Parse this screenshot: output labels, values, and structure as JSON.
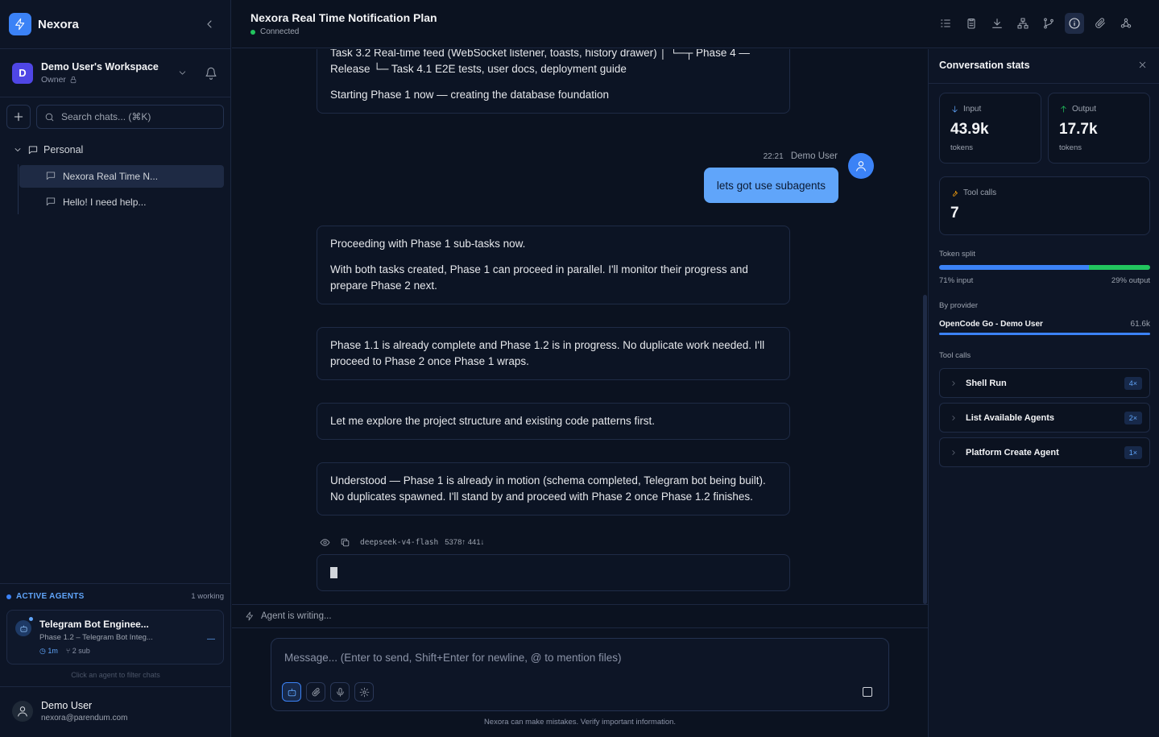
{
  "app": {
    "name": "Nexora",
    "accent_color": "#3b82f6"
  },
  "sidebar": {
    "workspace": {
      "avatar_letter": "D",
      "name": "Demo User's Workspace",
      "role": "Owner"
    },
    "search_placeholder": "Search chats... (⌘K)",
    "folder": {
      "name": "Personal"
    },
    "chats": [
      {
        "title": "Nexora Real Time N...",
        "active": true
      },
      {
        "title": "Hello! I need help...",
        "active": false
      }
    ],
    "active_agents": {
      "title": "ACTIVE AGENTS",
      "count": "1 working",
      "agent": {
        "name": "Telegram Bot Enginee...",
        "subtitle": "Phase 1.2 – Telegram Bot Integ...",
        "time": "1m",
        "sub": "2 sub"
      },
      "hint": "Click an agent to filter chats"
    },
    "user": {
      "name": "Demo User",
      "email": "nexora@parendum.com"
    }
  },
  "header": {
    "title": "Nexora Real Time Notification Plan",
    "status": "Connected",
    "status_color": "#22c55e",
    "toolbar_icons": [
      "checklist-icon",
      "clipboard-icon",
      "download-icon",
      "hierarchy-icon",
      "branch-icon",
      "info-icon",
      "paperclip-icon",
      "webhook-icon"
    ],
    "toolbar_active": "info-icon"
  },
  "chat": {
    "messages": [
      {
        "role": "assistant",
        "lines": [
          "Task 3.2 Real-time feed (WebSocket listener, toasts, history drawer) │ └─┬ Phase 4 — Release └─ Task 4.1 E2E tests, user docs, deployment guide",
          "Starting Phase 1 now — creating the database foundation"
        ]
      },
      {
        "role": "user",
        "time": "22:21",
        "author": "Demo User",
        "text": "lets got use subagents"
      },
      {
        "role": "assistant",
        "lines": [
          "Proceeding with Phase 1 sub-tasks now.",
          "With both tasks created, Phase 1 can proceed in parallel. I'll monitor their progress and prepare Phase 2 next."
        ]
      },
      {
        "role": "assistant",
        "lines": [
          "Phase 1.1 is already complete and Phase 1.2 is in progress. No duplicate work needed. I'll proceed to Phase 2 once Phase 1 wraps."
        ]
      },
      {
        "role": "assistant",
        "lines": [
          "Let me explore the project structure and existing code patterns first."
        ]
      },
      {
        "role": "assistant",
        "lines": [
          "Understood — Phase 1 is already in motion (schema completed, Telegram bot being built). No duplicates spawned. I'll stand by and proceed with Phase 2 once Phase 1.2 finishes."
        ]
      }
    ],
    "meta": {
      "model": "deepseek-v4-flash",
      "tokens": "5378↑ 441↓"
    },
    "writing_status": "Agent is writing..."
  },
  "composer": {
    "placeholder": "Message... (Enter to send, Shift+Enter for newline, @ to mention files)",
    "disclaimer": "Nexora can make mistakes. Verify important information."
  },
  "stats": {
    "title": "Conversation stats",
    "input": {
      "label": "Input",
      "value": "43.9k",
      "unit": "tokens"
    },
    "output": {
      "label": "Output",
      "value": "17.7k",
      "unit": "tokens"
    },
    "tool_calls_card": {
      "label": "Tool calls",
      "value": "7"
    },
    "token_split": {
      "label": "Token split",
      "input_pct": 71,
      "output_pct": 29,
      "input_label": "71% input",
      "output_label": "29% output"
    },
    "provider": {
      "label": "By provider",
      "name": "OpenCode Go - Demo User",
      "value": "61.6k",
      "share": 1.0
    },
    "tool_calls": {
      "label": "Tool calls",
      "items": [
        {
          "name": "Shell Run",
          "count": "4×"
        },
        {
          "name": "List Available Agents",
          "count": "2×"
        },
        {
          "name": "Platform Create Agent",
          "count": "1×"
        }
      ]
    }
  }
}
